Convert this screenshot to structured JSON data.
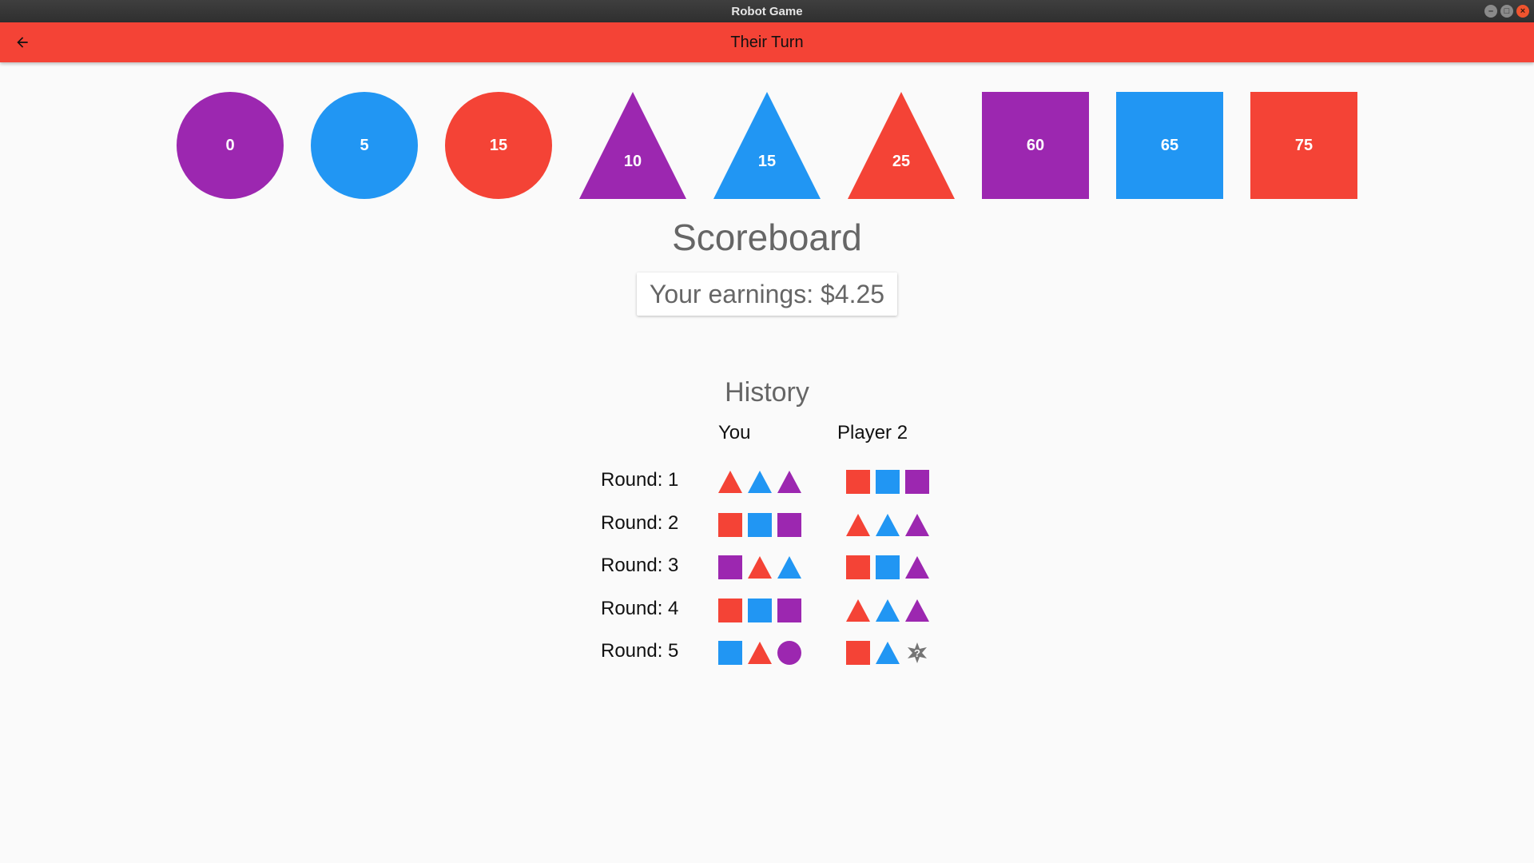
{
  "window": {
    "title": "Robot Game"
  },
  "appbar": {
    "title": "Their Turn"
  },
  "colors": {
    "red": "#f44336",
    "blue": "#2196f3",
    "purple": "#9c27b0",
    "grey": "#757575"
  },
  "shapes": [
    {
      "type": "circle",
      "color": "purple",
      "value": "0"
    },
    {
      "type": "circle",
      "color": "blue",
      "value": "5"
    },
    {
      "type": "circle",
      "color": "red",
      "value": "15"
    },
    {
      "type": "triangle",
      "color": "purple",
      "value": "10"
    },
    {
      "type": "triangle",
      "color": "blue",
      "value": "15"
    },
    {
      "type": "triangle",
      "color": "red",
      "value": "25"
    },
    {
      "type": "square",
      "color": "purple",
      "value": "60"
    },
    {
      "type": "square",
      "color": "blue",
      "value": "65"
    },
    {
      "type": "square",
      "color": "red",
      "value": "75"
    }
  ],
  "scoreboard": {
    "title": "Scoreboard",
    "earnings": "Your earnings: $4.25"
  },
  "history": {
    "title": "History",
    "col_you": "You",
    "col_player2": "Player 2",
    "rounds": [
      {
        "label": "Round: 1",
        "you": [
          [
            "triangle",
            "red"
          ],
          [
            "triangle",
            "blue"
          ],
          [
            "triangle",
            "purple"
          ]
        ],
        "player2": [
          [
            "square",
            "red"
          ],
          [
            "square",
            "blue"
          ],
          [
            "square",
            "purple"
          ]
        ]
      },
      {
        "label": "Round: 2",
        "you": [
          [
            "square",
            "red"
          ],
          [
            "square",
            "blue"
          ],
          [
            "square",
            "purple"
          ]
        ],
        "player2": [
          [
            "triangle",
            "red"
          ],
          [
            "triangle",
            "blue"
          ],
          [
            "triangle",
            "purple"
          ]
        ]
      },
      {
        "label": "Round: 3",
        "you": [
          [
            "square",
            "purple"
          ],
          [
            "triangle",
            "red"
          ],
          [
            "triangle",
            "blue"
          ]
        ],
        "player2": [
          [
            "square",
            "red"
          ],
          [
            "square",
            "blue"
          ],
          [
            "triangle",
            "purple"
          ]
        ]
      },
      {
        "label": "Round: 4",
        "you": [
          [
            "square",
            "red"
          ],
          [
            "square",
            "blue"
          ],
          [
            "square",
            "purple"
          ]
        ],
        "player2": [
          [
            "triangle",
            "red"
          ],
          [
            "triangle",
            "blue"
          ],
          [
            "triangle",
            "purple"
          ]
        ]
      },
      {
        "label": "Round: 5",
        "you": [
          [
            "square",
            "blue"
          ],
          [
            "triangle",
            "red"
          ],
          [
            "circle",
            "purple"
          ]
        ],
        "player2": [
          [
            "square",
            "red"
          ],
          [
            "triangle",
            "blue"
          ],
          [
            "unknown",
            "grey"
          ]
        ]
      }
    ]
  }
}
